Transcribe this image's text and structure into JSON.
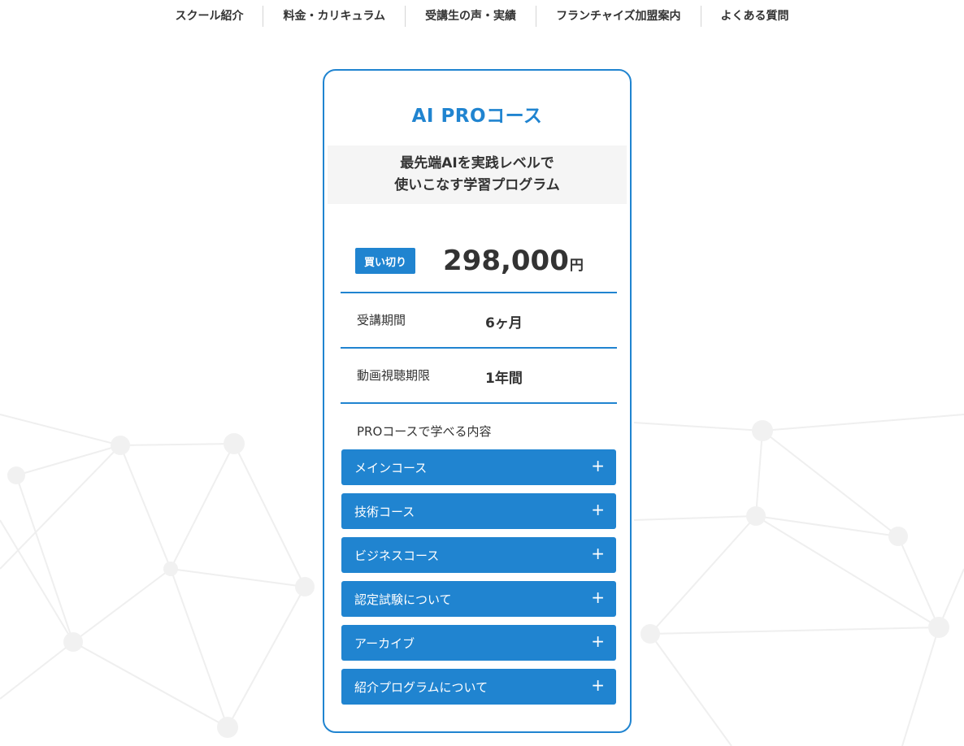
{
  "nav": {
    "items": [
      {
        "label": "スクール紹介"
      },
      {
        "label": "料金・カリキュラム"
      },
      {
        "label": "受講生の声・実績"
      },
      {
        "label": "フランチャイズ加盟案内"
      },
      {
        "label": "よくある質問"
      }
    ]
  },
  "card": {
    "title": "AI PROコース",
    "subtitle_line1": "最先端AIを実践レベルで",
    "subtitle_line2": "使いこなす学習プログラム",
    "badge": "買い切り",
    "price": "298,000",
    "price_unit": "円",
    "rows": [
      {
        "label": "受講期間",
        "value": "6ヶ月"
      },
      {
        "label": "動画視聴期限",
        "value": "1年間"
      }
    ],
    "learn_heading": "PROコースで学べる内容",
    "accordion": [
      {
        "label": "メインコース",
        "icon": "plus-icon",
        "symbol": "+"
      },
      {
        "label": "技術コース",
        "icon": "plus-icon",
        "symbol": "+"
      },
      {
        "label": "ビジネスコース",
        "icon": "plus-icon",
        "symbol": "+"
      },
      {
        "label": "認定試験について",
        "icon": "plus-icon",
        "symbol": "+"
      },
      {
        "label": "アーカイブ",
        "icon": "plus-icon",
        "symbol": "+"
      },
      {
        "label": "紹介プログラムについて",
        "icon": "plus-icon",
        "symbol": "+"
      }
    ]
  },
  "colors": {
    "accent": "#2084d0",
    "text": "#333333",
    "subtitle_bg": "#f5f5f5"
  }
}
